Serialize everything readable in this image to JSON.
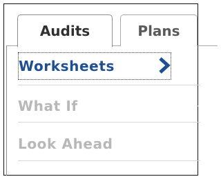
{
  "tabs": [
    {
      "label": "Audits",
      "selected": true
    },
    {
      "label": "Plans",
      "selected": false
    }
  ],
  "menu": {
    "items": [
      {
        "label": "Worksheets",
        "state": "active",
        "icon": "chevron-right-icon"
      },
      {
        "label": "What If",
        "state": "disabled"
      },
      {
        "label": "Look Ahead",
        "state": "disabled"
      }
    ]
  },
  "colors": {
    "active_text": "#1f4f93",
    "disabled_text": "#b8b8b8",
    "tab_text": "#303030",
    "divider": "#d7d7d7",
    "border": "#111111"
  }
}
